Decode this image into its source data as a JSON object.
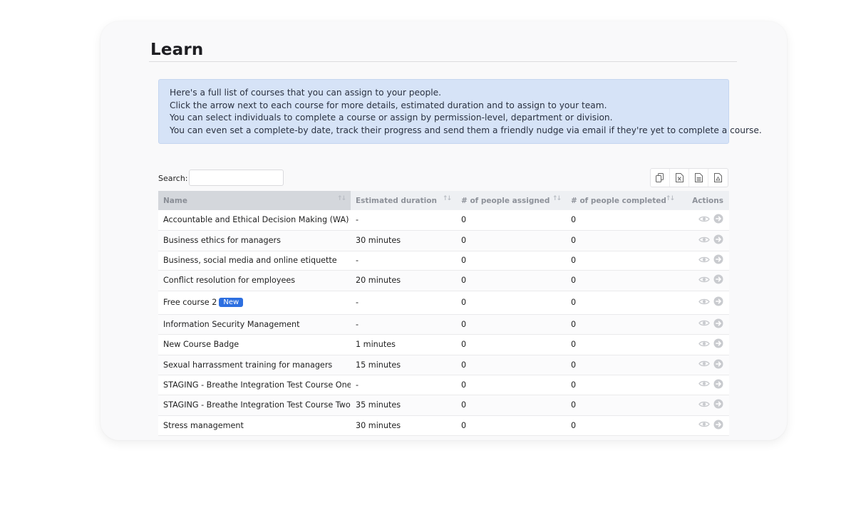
{
  "page": {
    "title": "Learn"
  },
  "info": {
    "lines": [
      "Here's a full list of courses that you can assign to your people.",
      "Click the arrow next to each course for more details, estimated duration and to assign to your team.",
      "You can select individuals to complete a course or assign by permission-level, department or division.",
      "You can even set a complete-by date, track their progress and send them a friendly nudge via email if they're yet to complete a course."
    ]
  },
  "search": {
    "label": "Search:",
    "value": "",
    "placeholder": ""
  },
  "export": {
    "icons": [
      "copy-icon",
      "excel-icon",
      "csv-icon",
      "pdf-icon"
    ]
  },
  "table": {
    "headers": [
      "Name",
      "Estimated duration",
      "# of people assigned",
      "# of people completed",
      "Actions"
    ],
    "rows": [
      {
        "name": "Accountable and Ethical Decision Making (WA)",
        "duration": "-",
        "assigned": "0",
        "completed": "0",
        "badge": ""
      },
      {
        "name": "Business ethics for managers",
        "duration": "30 minutes",
        "assigned": "0",
        "completed": "0",
        "badge": ""
      },
      {
        "name": "Business, social media and online etiquette",
        "duration": "-",
        "assigned": "0",
        "completed": "0",
        "badge": ""
      },
      {
        "name": "Conflict resolution for employees",
        "duration": "20 minutes",
        "assigned": "0",
        "completed": "0",
        "badge": ""
      },
      {
        "name": "Free course 2",
        "duration": "-",
        "assigned": "0",
        "completed": "0",
        "badge": "New"
      },
      {
        "name": "Information Security Management",
        "duration": "-",
        "assigned": "0",
        "completed": "0",
        "badge": ""
      },
      {
        "name": "New Course Badge",
        "duration": "1 minutes",
        "assigned": "0",
        "completed": "0",
        "badge": ""
      },
      {
        "name": "Sexual harrassment training for managers",
        "duration": "15 minutes",
        "assigned": "0",
        "completed": "0",
        "badge": ""
      },
      {
        "name": "STAGING - Breathe Integration Test Course One",
        "duration": "-",
        "assigned": "0",
        "completed": "0",
        "badge": ""
      },
      {
        "name": "STAGING - Breathe Integration Test Course Two",
        "duration": "35 minutes",
        "assigned": "0",
        "completed": "0",
        "badge": ""
      },
      {
        "name": "Stress management",
        "duration": "30 minutes",
        "assigned": "0",
        "completed": "0",
        "badge": ""
      }
    ]
  },
  "colors": {
    "accent": "#2d6fe0",
    "info_bg": "#d6e3f7",
    "action_icon": "#c9cbcf"
  }
}
